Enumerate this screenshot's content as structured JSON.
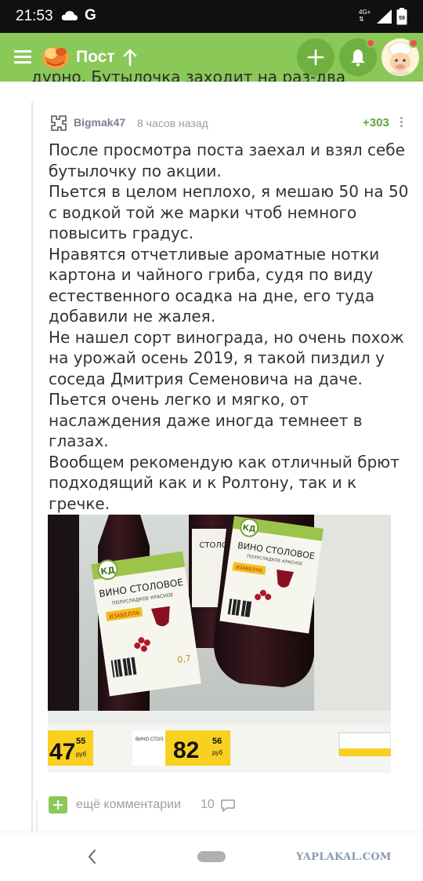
{
  "status_bar": {
    "time": "21:53",
    "carrier_glyph": "G",
    "network": "4G+",
    "battery": "59"
  },
  "header": {
    "title": "Пост",
    "icons": [
      "menu-icon",
      "logo-icon",
      "arrow-up-icon",
      "plus-icon",
      "bell-icon",
      "avatar"
    ],
    "color_accent": "#8ac858",
    "color_button": "#6fb040",
    "color_notification": "#f05050"
  },
  "previous_text": "дурно. Бутылочка заходит на раз-два",
  "comment": {
    "author": "Bigmak47",
    "time": "8 часов назад",
    "rating": "+303",
    "lines": [
      "После просмотра поста заехал и взял себе",
      "бутылочку по акции.",
      "Пьется в целом неплохо, я мешаю 50 на 50",
      "с водкой той же марки чтоб немного",
      "повысить градус.",
      "Нравятся отчетливые ароматные нотки",
      "картона и чайного гриба, судя по виду",
      "естественного осадка на дне, его туда",
      "добавили не жалея.",
      "Не нашел сорт винограда, но очень похож",
      "на урожай осень 2019, я такой пиздил у",
      "соседа Дмитрия Семеновича на даче.",
      "Пьется очень легко и мягко, от",
      "наслаждения даже иногда темнеет в",
      "глазах.",
      "Вообщем рекомендую как отличный брют",
      "подходящий как и к Ролтону, так и к",
      "гречке."
    ],
    "photo": {
      "bottle_label_title": "ВИНО СТОЛОВОЕ",
      "bottle_label_sub": "ПОЛУСЛАДКОЕ КРАСНОЕ",
      "bottle_variety": "ИЗАБЕЛЛА",
      "bottle_brand": "КД",
      "bottle_volume": "0,7",
      "price_left_main": "47",
      "price_left_cents": "55",
      "price_main": "82",
      "price_cents": "56",
      "currency": "руб"
    }
  },
  "more_comments": {
    "label": "ещё комментарии",
    "count": "10"
  },
  "nav": {
    "watermark": "YAPLAKAL.COM"
  }
}
